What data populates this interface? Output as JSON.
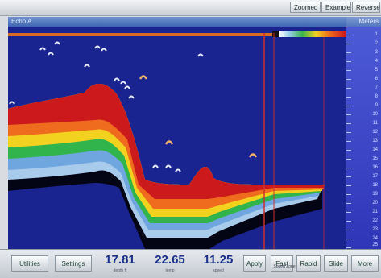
{
  "topbar": {
    "buttons": [
      "Zoomed",
      "Example",
      "Reverse"
    ]
  },
  "header": {
    "title": "Echo A",
    "right_label": "Meters"
  },
  "scale": {
    "labels": [
      "1",
      "2",
      "3",
      "4",
      "5",
      "6",
      "7",
      "8",
      "9",
      "10",
      "11",
      "12",
      "13",
      "14",
      "15",
      "16",
      "17",
      "18",
      "19",
      "20",
      "21",
      "22",
      "23",
      "24",
      "25"
    ]
  },
  "bottombar": {
    "buttons": [
      "Utilities",
      "Settings",
      "Apply",
      "Fast",
      "Rapid",
      "Slide",
      "More"
    ],
    "readouts": [
      {
        "value": "17.81",
        "label": "depth ft"
      },
      {
        "value": "22.65",
        "label": "temp"
      },
      {
        "value": "11.25",
        "label": "speed"
      }
    ],
    "speed_label": "Speed Zone"
  },
  "colors": {
    "water": "#1a2490",
    "accent": "#d86a28",
    "marker": "#c9302c"
  }
}
